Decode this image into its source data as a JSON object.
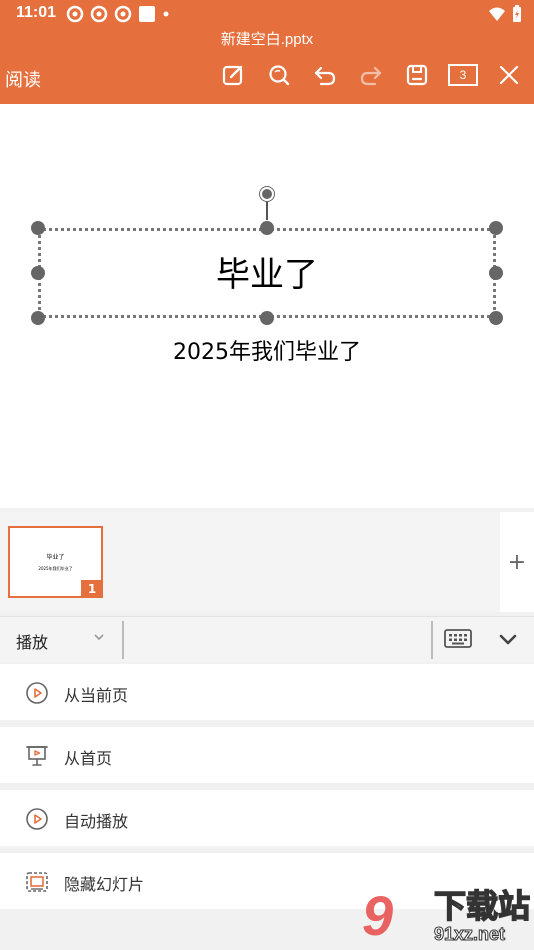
{
  "status_bar": {
    "time": "11:01"
  },
  "header": {
    "doc_title": "新建空白.pptx",
    "read_label": "阅读",
    "page_count": "3"
  },
  "slide": {
    "title": "毕业了",
    "subtitle": "2025年我们毕业了"
  },
  "thumbnail": {
    "title": "毕业了",
    "subtitle": "2025年我们毕业了",
    "number": "1",
    "add_label": "+"
  },
  "menu": {
    "selected": "播放",
    "options": [
      {
        "label": "从当前页",
        "icon": "play-circle-icon"
      },
      {
        "label": "从首页",
        "icon": "projector-icon"
      },
      {
        "label": "自动播放",
        "icon": "play-circle-icon"
      },
      {
        "label": "隐藏幻灯片",
        "icon": "hidden-slide-icon"
      }
    ]
  },
  "watermark": {
    "digit": "9",
    "text": "下载站",
    "url": "91xz.net"
  },
  "colors": {
    "accent": "#e5703e",
    "background": "#f1f1f1"
  }
}
